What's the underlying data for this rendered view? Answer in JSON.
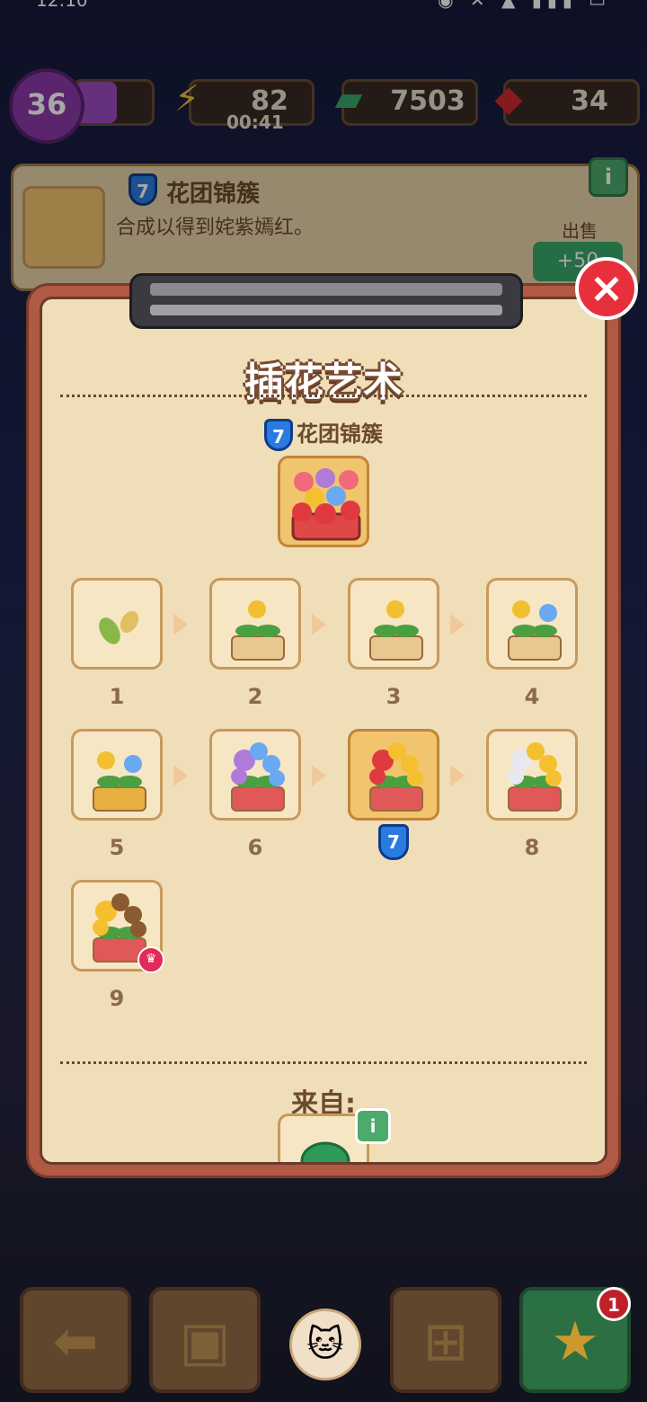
{
  "status": {
    "time": "12:10",
    "icons": "◉ ✕ ▲ ▮▮▮ ▭"
  },
  "resources": {
    "level": "36",
    "xp_fraction": 0.55,
    "energy": "82",
    "energy_timer": "00:41",
    "cash": "7503",
    "gems": "34"
  },
  "info_card": {
    "level_badge": "7",
    "title": "花团锦簇",
    "description": "合成以得到姹紫嫣红。",
    "sell_label": "出售",
    "sell_value": "+50"
  },
  "modal": {
    "title": "插花艺术",
    "item_level": "7",
    "item_name": "花团锦簇",
    "chain": [
      {
        "level": "1"
      },
      {
        "level": "2"
      },
      {
        "level": "3"
      },
      {
        "level": "4"
      },
      {
        "level": "5"
      },
      {
        "level": "6"
      },
      {
        "level": "7"
      },
      {
        "level": "8"
      },
      {
        "level": "9"
      }
    ],
    "current_badge": "7",
    "from_label": "来自:",
    "close_icon": "close-icon"
  },
  "nav": {
    "badge_count": "1"
  },
  "colors": {
    "accent_green": "#3aa86a",
    "close_red": "#e8303c",
    "panel": "#f0deb8"
  }
}
